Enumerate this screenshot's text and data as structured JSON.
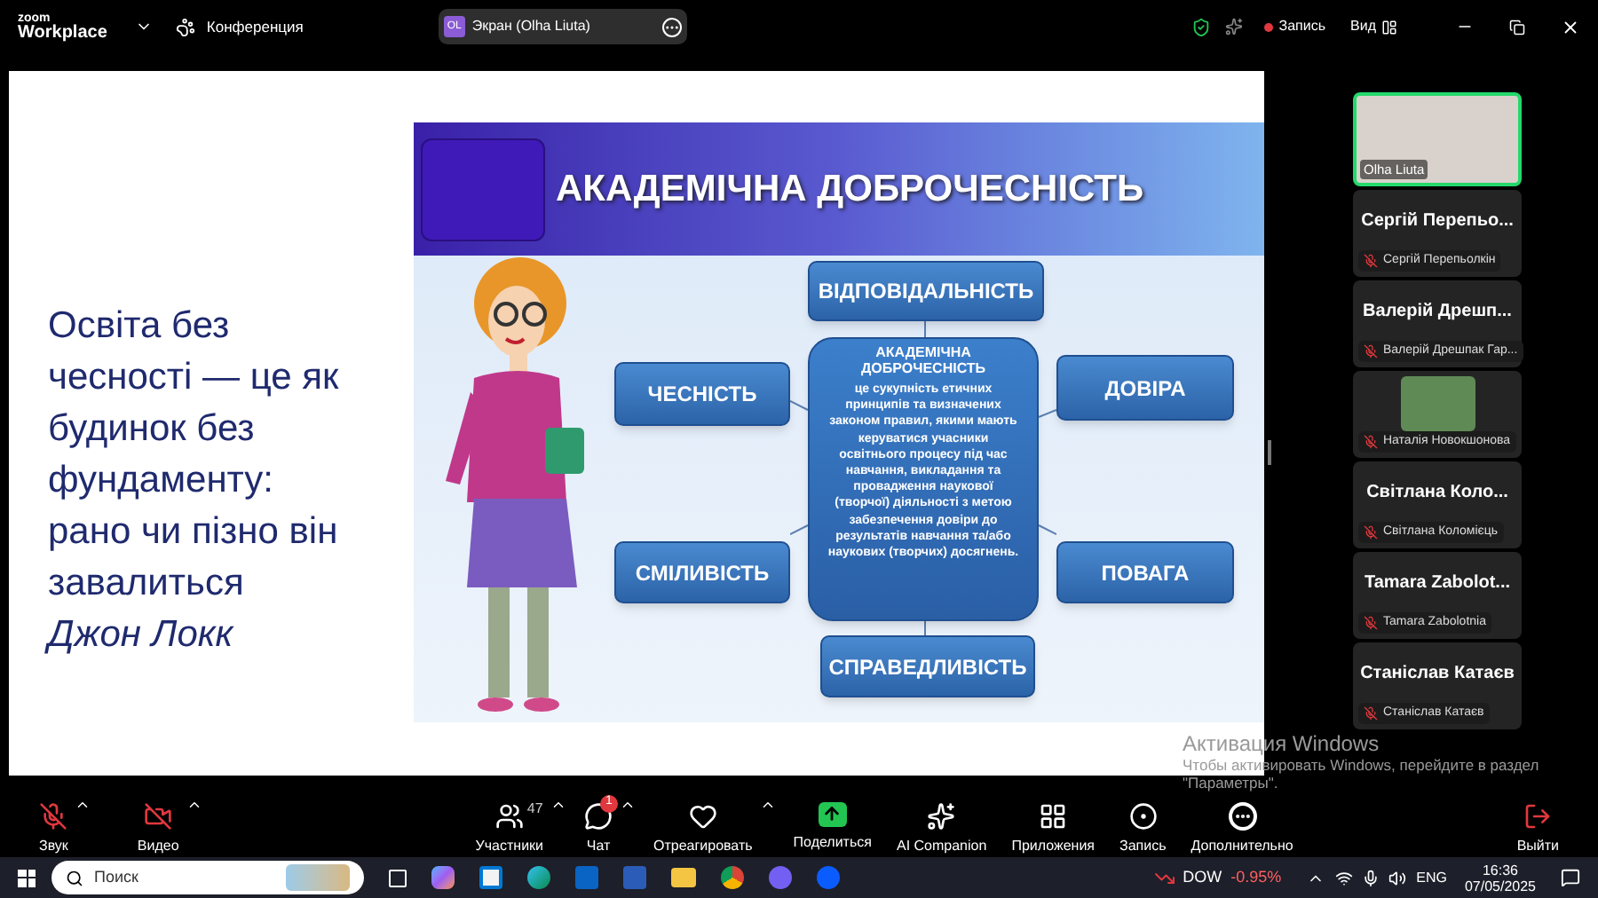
{
  "top_bar": {
    "logo_small": "zoom",
    "logo": "Workplace",
    "meeting": "Конференция",
    "share_pill": {
      "initials": "OL",
      "label": "Экран (Olha Liuta)"
    },
    "record": "Запись",
    "view": "Вид"
  },
  "slide": {
    "quote_lines": [
      "Освіта без",
      "чесності — це як",
      "будинок без",
      "фундаменту:",
      "рано чи пізно він",
      "завалиться"
    ],
    "author": "Джон Локк",
    "graphic": {
      "title": "АКАДЕМІЧНА ДОБРОЧЕСНІСТЬ",
      "center_title": "АКАДЕМІЧНА ДОБРОЧЕСНІСТЬ",
      "center_text": "це сукупність етичних принципів та визначених законом правил, якими мають керуватися учасники освітнього процесу під час навчання, викладання та провадження наукової (творчої) діяльності з метою забезпечення довіри до результатів навчання та/або наукових (творчих) досягнень.",
      "values": [
        {
          "label": "ВІДПОВІДАЛЬНІСТЬ",
          "kind": "top"
        },
        {
          "label": "ЧЕСНІСТЬ",
          "kind": "left_top"
        },
        {
          "label": "ДОВІРА",
          "kind": "right_top"
        },
        {
          "label": "СМІЛИВІСТЬ",
          "kind": "left_bottom"
        },
        {
          "label": "ПОВАГА",
          "kind": "right_bottom"
        },
        {
          "label": "СПРАВЕДЛИВІСТЬ",
          "kind": "bottom"
        }
      ]
    }
  },
  "participants": [
    {
      "kind": "video",
      "label": "Olha Liuta",
      "speaking": true
    },
    {
      "kind": "name",
      "name": "Сергій Перепьо...",
      "label": "Сергій Перепьолкін",
      "muted": true
    },
    {
      "kind": "name",
      "name": "Валерій Дрешп...",
      "label": "Валерій Дрешпак Гар...",
      "muted": true
    },
    {
      "kind": "picture",
      "label": "Наталія Новокшонова",
      "muted": true
    },
    {
      "kind": "name",
      "name": "Світлана Коло...",
      "label": "Світлана Коломієць",
      "muted": true
    },
    {
      "kind": "name",
      "name": "Tamara Zabolot...",
      "label": "Tamara Zabolotnia",
      "muted": true
    },
    {
      "kind": "name",
      "name": "Станіслав Катаєв",
      "label": "Станіслав Катаєв",
      "muted": true
    }
  ],
  "toolbar": {
    "left": [
      {
        "kind": "mic",
        "label": "Звук",
        "on": false,
        "menu": true
      },
      {
        "kind": "video",
        "label": "Видео",
        "on": false,
        "menu": true
      }
    ],
    "center": [
      {
        "kind": "participants",
        "label": "Участники",
        "count": "47",
        "menu": true
      },
      {
        "kind": "chat",
        "label": "Чат",
        "badge": "1",
        "menu": true
      },
      {
        "kind": "react",
        "label": "Отреагировать",
        "menu": true
      },
      {
        "kind": "share",
        "label": "Поделиться",
        "menu": false
      },
      {
        "kind": "ai",
        "label": "AI Companion",
        "menu": false
      },
      {
        "kind": "apps",
        "label": "Приложения",
        "menu": false
      },
      {
        "kind": "record",
        "label": "Запись",
        "menu": false
      },
      {
        "kind": "more",
        "label": "Дополнительно",
        "menu": false
      }
    ],
    "right": [
      {
        "kind": "leave",
        "label": "Выйти",
        "menu": false
      }
    ]
  },
  "activation": {
    "title": "Активация Windows",
    "text": "Чтобы активировать Windows, перейдите в раздел \"Параметры\"."
  },
  "taskbar": {
    "search_placeholder": "Поиск",
    "ticker": "DOW",
    "change": "-0.95%",
    "language": "ENG",
    "time": "16:36",
    "date": "07/05/2025"
  }
}
